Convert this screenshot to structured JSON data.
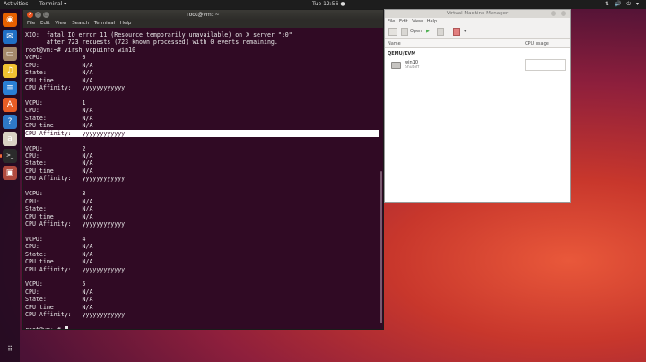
{
  "top_bar": {
    "activities": "Activities",
    "app_menu": "Terminal ▾",
    "clock": "Tue 12:56 ●",
    "tray": "⇅ 🔊 ⏻ ▾"
  },
  "dock": {
    "items": [
      {
        "name": "firefox-icon",
        "glyph": "◉",
        "color": "#e66000"
      },
      {
        "name": "thunderbird-icon",
        "glyph": "✉",
        "color": "#1f6fc5"
      },
      {
        "name": "files-icon",
        "glyph": "▭",
        "color": "#a3896a"
      },
      {
        "name": "rhythmbox-icon",
        "glyph": "♫",
        "color": "#f1c232"
      },
      {
        "name": "writer-icon",
        "glyph": "≡",
        "color": "#2a7fd4"
      },
      {
        "name": "software-icon",
        "glyph": "A",
        "color": "#e85c25"
      },
      {
        "name": "help-icon",
        "glyph": "?",
        "color": "#2e79c7"
      },
      {
        "name": "amazon-icon",
        "glyph": "a",
        "color": "#d8d2c4"
      },
      {
        "name": "terminal-icon",
        "glyph": ">_",
        "color": "#2b2b2b"
      },
      {
        "name": "virt-manager-icon",
        "glyph": "▣",
        "color": "#b04a3e"
      }
    ]
  },
  "terminal": {
    "title": "root@vm: ~",
    "menu": [
      "File",
      "Edit",
      "View",
      "Search",
      "Terminal",
      "Help"
    ],
    "lines": [
      "XIO:  fatal IO error 11 (Resource temporarily unavailable) on X server \":0\"",
      "      after 723 requests (723 known processed) with 0 events remaining.",
      "root@vm:~# virsh vcpuinfo win10",
      "VCPU:           0",
      "CPU:            N/A",
      "State:          N/A",
      "CPU time        N/A",
      "CPU Affinity:   yyyyyyyyyyyy",
      "",
      "VCPU:           1",
      "CPU:            N/A",
      "State:          N/A",
      "CPU time        N/A",
      "CPU Affinity:   yyyyyyyyyyyy",
      "",
      "VCPU:           2",
      "CPU:            N/A",
      "State:          N/A",
      "CPU time        N/A",
      "CPU Affinity:   yyyyyyyyyyyy",
      "",
      "VCPU:           3",
      "CPU:            N/A",
      "State:          N/A",
      "CPU time        N/A",
      "CPU Affinity:   yyyyyyyyyyyy",
      "",
      "VCPU:           4",
      "CPU:            N/A",
      "State:          N/A",
      "CPU time        N/A",
      "CPU Affinity:   yyyyyyyyyyyy",
      "",
      "VCPU:           5",
      "CPU:            N/A",
      "State:          N/A",
      "CPU time        N/A",
      "CPU Affinity:   yyyyyyyyyyyy",
      "",
      "root@vm:~# "
    ],
    "selected_line_index": 13
  },
  "vmm": {
    "title": "Virtual Machine Manager",
    "menu": [
      "File",
      "Edit",
      "View",
      "Help"
    ],
    "toolbar": {
      "open_label": "Open"
    },
    "columns": {
      "name": "Name",
      "cpu_usage": "CPU usage"
    },
    "group": "QEMU/KVM",
    "vm": {
      "name": "win10",
      "status": "Shutoff"
    }
  }
}
